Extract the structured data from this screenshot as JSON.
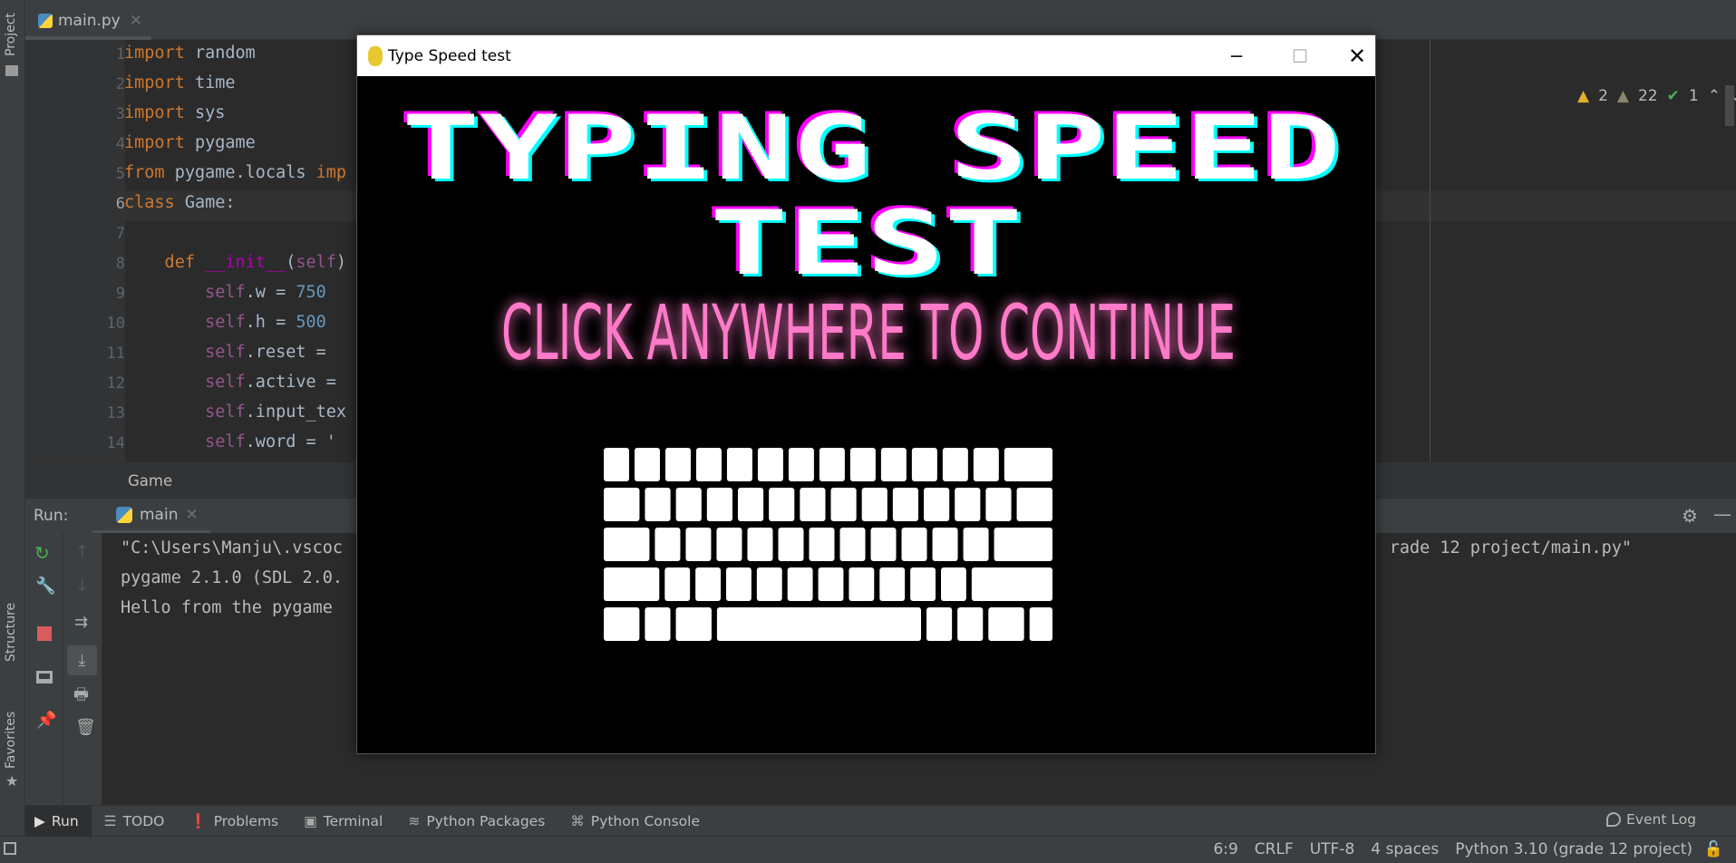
{
  "sidebar": {
    "project": "Project",
    "structure": "Structure",
    "favorites": "Favorites"
  },
  "tab": {
    "label": "main.py"
  },
  "editor": {
    "line_numbers": [
      "1",
      "2",
      "3",
      "4",
      "5",
      "6",
      "7",
      "8",
      "9",
      "10",
      "11",
      "12",
      "13",
      "14"
    ],
    "lines": [
      [
        [
          "import",
          "kw"
        ],
        [
          " random",
          "pl"
        ]
      ],
      [
        [
          "import",
          "kw"
        ],
        [
          " time",
          "pl"
        ]
      ],
      [
        [
          "import",
          "kw"
        ],
        [
          " sys",
          "pl"
        ]
      ],
      [
        [
          "import",
          "kw"
        ],
        [
          " pygame",
          "pl"
        ]
      ],
      [
        [
          "from",
          "kw"
        ],
        [
          " pygame.locals ",
          "pl"
        ],
        [
          "imp",
          "kw"
        ]
      ],
      [
        [
          "class",
          "kw"
        ],
        [
          " Game:",
          "pl"
        ]
      ],
      [],
      [
        [
          "    def ",
          "kw"
        ],
        [
          "__init__",
          "magic"
        ],
        [
          "(",
          "pl"
        ],
        [
          "self",
          "self"
        ],
        [
          ")",
          "pl"
        ]
      ],
      [
        [
          "        ",
          "pl"
        ],
        [
          "self",
          "self"
        ],
        [
          ".w = ",
          "pl"
        ],
        [
          "750",
          "num"
        ]
      ],
      [
        [
          "        ",
          "pl"
        ],
        [
          "self",
          "self"
        ],
        [
          ".h = ",
          "pl"
        ],
        [
          "500",
          "num"
        ]
      ],
      [
        [
          "        ",
          "pl"
        ],
        [
          "self",
          "self"
        ],
        [
          ".reset = ",
          "pl"
        ]
      ],
      [
        [
          "        ",
          "pl"
        ],
        [
          "self",
          "self"
        ],
        [
          ".active = ",
          "pl"
        ]
      ],
      [
        [
          "        ",
          "pl"
        ],
        [
          "self",
          "self"
        ],
        [
          ".input_tex",
          "pl"
        ]
      ],
      [
        [
          "        ",
          "pl"
        ],
        [
          "self",
          "self"
        ],
        [
          ".word = '",
          "pl"
        ]
      ]
    ],
    "current_line": 6,
    "inspections": {
      "warnings": "2",
      "weak_warnings": "22",
      "typos": "1"
    },
    "breadcrumb": "Game"
  },
  "run": {
    "label": "Run:",
    "tab": "main",
    "console": [
      {
        "left": "\"C:\\Users\\Manju\\.vscoc",
        "right": "rade 12 project/main.py\""
      },
      {
        "left": "pygame 2.1.0 (SDL 2.0."
      },
      {
        "left": "Hello from the pygame"
      }
    ]
  },
  "tool_tabs": [
    {
      "label": "Run",
      "icon": "play-icon",
      "active": true
    },
    {
      "label": "TODO",
      "icon": "list-icon"
    },
    {
      "label": "Problems",
      "icon": "problems-icon"
    },
    {
      "label": "Terminal",
      "icon": "terminal-icon"
    },
    {
      "label": "Python Packages",
      "icon": "layers-icon"
    },
    {
      "label": "Python Console",
      "icon": "python-icon"
    }
  ],
  "event_log": "Event Log",
  "status": {
    "position": "6:9",
    "line_sep": "CRLF",
    "encoding": "UTF-8",
    "indent": "4 spaces",
    "interpreter": "Python 3.10 (grade 12 project)"
  },
  "pygame_window": {
    "title": "Type Speed test",
    "heading_line1": "TYPING SPEED",
    "heading_line2": "TEST",
    "prompt": "CLICK ANYWHERE TO CONTINUE",
    "colors": {
      "heading": "#ffffff",
      "shadow_magenta": "#ff00ff",
      "shadow_cyan": "#00ffff",
      "prompt": "#ff7ac8"
    }
  }
}
